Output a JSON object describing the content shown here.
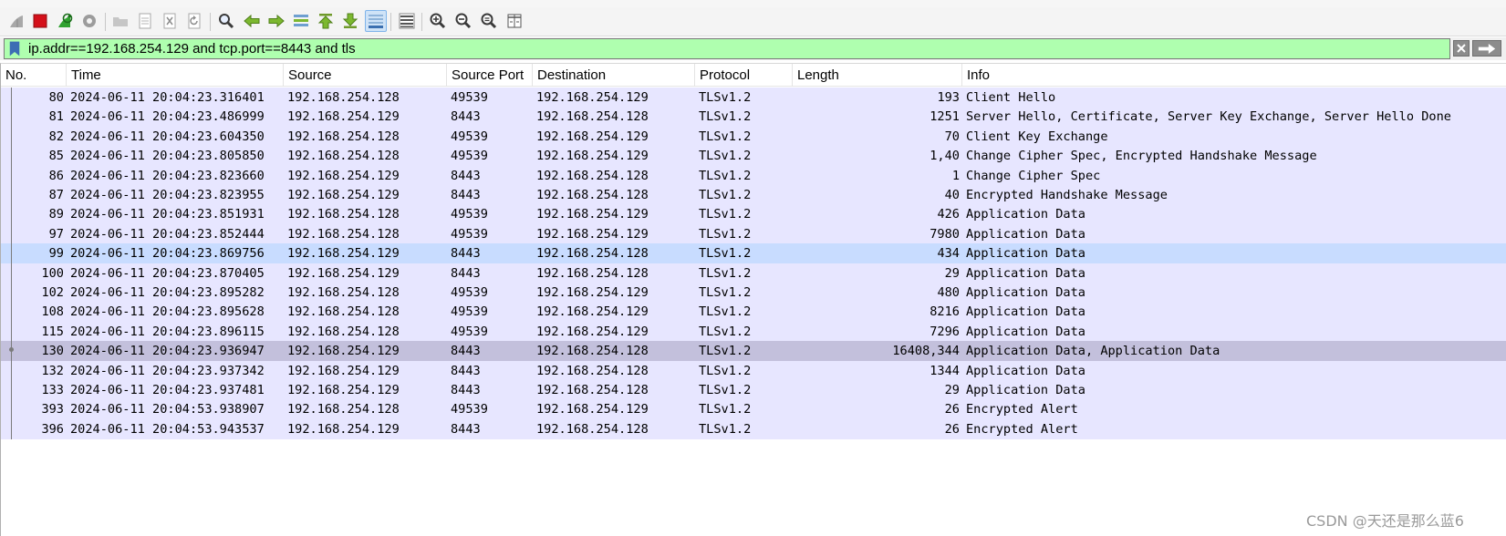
{
  "filter": {
    "value": "ip.addr==192.168.254.129 and tcp.port==8443 and tls"
  },
  "toolbar": {
    "icons": [
      "shark-fin-start-icon",
      "stop-icon",
      "restart-icon",
      "options-gear-icon",
      "open-folder-icon",
      "save-file-icon",
      "close-file-icon",
      "reload-icon",
      "find-icon",
      "back-arrow-icon",
      "forward-arrow-icon",
      "go-to-packet-icon",
      "first-packet-icon",
      "last-packet-icon",
      "autoscroll-icon",
      "colorize-icon",
      "zoom-in-icon",
      "zoom-out-icon",
      "zoom-reset-icon",
      "resize-columns-icon"
    ]
  },
  "columns": [
    "No.",
    "Time",
    "Source",
    "Source Port",
    "Destination",
    "Protocol",
    "Length",
    "Info"
  ],
  "packets": [
    {
      "no": "80",
      "time": "2024-06-11 20:04:23.316401",
      "src": "192.168.254.128",
      "sport": "49539",
      "dst": "192.168.254.129",
      "proto": "TLSv1.2",
      "len": "193",
      "info": "Client Hello"
    },
    {
      "no": "81",
      "time": "2024-06-11 20:04:23.486999",
      "src": "192.168.254.129",
      "sport": "8443",
      "dst": "192.168.254.128",
      "proto": "TLSv1.2",
      "len": "1251",
      "info": "Server Hello, Certificate, Server Key Exchange, Server Hello Done"
    },
    {
      "no": "82",
      "time": "2024-06-11 20:04:23.604350",
      "src": "192.168.254.128",
      "sport": "49539",
      "dst": "192.168.254.129",
      "proto": "TLSv1.2",
      "len": "70",
      "info": "Client Key Exchange"
    },
    {
      "no": "85",
      "time": "2024-06-11 20:04:23.805850",
      "src": "192.168.254.128",
      "sport": "49539",
      "dst": "192.168.254.129",
      "proto": "TLSv1.2",
      "len": "1,40",
      "info": "Change Cipher Spec, Encrypted Handshake Message"
    },
    {
      "no": "86",
      "time": "2024-06-11 20:04:23.823660",
      "src": "192.168.254.129",
      "sport": "8443",
      "dst": "192.168.254.128",
      "proto": "TLSv1.2",
      "len": "1",
      "info": "Change Cipher Spec"
    },
    {
      "no": "87",
      "time": "2024-06-11 20:04:23.823955",
      "src": "192.168.254.129",
      "sport": "8443",
      "dst": "192.168.254.128",
      "proto": "TLSv1.2",
      "len": "40",
      "info": "Encrypted Handshake Message"
    },
    {
      "no": "89",
      "time": "2024-06-11 20:04:23.851931",
      "src": "192.168.254.128",
      "sport": "49539",
      "dst": "192.168.254.129",
      "proto": "TLSv1.2",
      "len": "426",
      "info": "Application Data"
    },
    {
      "no": "97",
      "time": "2024-06-11 20:04:23.852444",
      "src": "192.168.254.128",
      "sport": "49539",
      "dst": "192.168.254.129",
      "proto": "TLSv1.2",
      "len": "7980",
      "info": "Application Data"
    },
    {
      "no": "99",
      "time": "2024-06-11 20:04:23.869756",
      "src": "192.168.254.129",
      "sport": "8443",
      "dst": "192.168.254.128",
      "proto": "TLSv1.2",
      "len": "434",
      "info": "Application Data"
    },
    {
      "no": "100",
      "time": "2024-06-11 20:04:23.870405",
      "src": "192.168.254.129",
      "sport": "8443",
      "dst": "192.168.254.128",
      "proto": "TLSv1.2",
      "len": "29",
      "info": "Application Data"
    },
    {
      "no": "102",
      "time": "2024-06-11 20:04:23.895282",
      "src": "192.168.254.128",
      "sport": "49539",
      "dst": "192.168.254.129",
      "proto": "TLSv1.2",
      "len": "480",
      "info": "Application Data"
    },
    {
      "no": "108",
      "time": "2024-06-11 20:04:23.895628",
      "src": "192.168.254.128",
      "sport": "49539",
      "dst": "192.168.254.129",
      "proto": "TLSv1.2",
      "len": "8216",
      "info": "Application Data"
    },
    {
      "no": "115",
      "time": "2024-06-11 20:04:23.896115",
      "src": "192.168.254.128",
      "sport": "49539",
      "dst": "192.168.254.129",
      "proto": "TLSv1.2",
      "len": "7296",
      "info": "Application Data"
    },
    {
      "no": "130",
      "time": "2024-06-11 20:04:23.936947",
      "src": "192.168.254.129",
      "sport": "8443",
      "dst": "192.168.254.128",
      "proto": "TLSv1.2",
      "len": "16408,344",
      "info": "Application Data, Application Data"
    },
    {
      "no": "132",
      "time": "2024-06-11 20:04:23.937342",
      "src": "192.168.254.129",
      "sport": "8443",
      "dst": "192.168.254.128",
      "proto": "TLSv1.2",
      "len": "1344",
      "info": "Application Data"
    },
    {
      "no": "133",
      "time": "2024-06-11 20:04:23.937481",
      "src": "192.168.254.129",
      "sport": "8443",
      "dst": "192.168.254.128",
      "proto": "TLSv1.2",
      "len": "29",
      "info": "Application Data"
    },
    {
      "no": "393",
      "time": "2024-06-11 20:04:53.938907",
      "src": "192.168.254.128",
      "sport": "49539",
      "dst": "192.168.254.129",
      "proto": "TLSv1.2",
      "len": "26",
      "info": "Encrypted Alert"
    },
    {
      "no": "396",
      "time": "2024-06-11 20:04:53.943537",
      "src": "192.168.254.129",
      "sport": "8443",
      "dst": "192.168.254.128",
      "proto": "TLSv1.2",
      "len": "26",
      "info": "Encrypted Alert"
    }
  ],
  "row_colors": {
    "tcp_default": "#e7e6ff",
    "selected": "#c8dcff",
    "marked": "#c3c0dc",
    "filter_valid": "#afffaf"
  },
  "watermark": "CSDN @天还是那么蓝6"
}
